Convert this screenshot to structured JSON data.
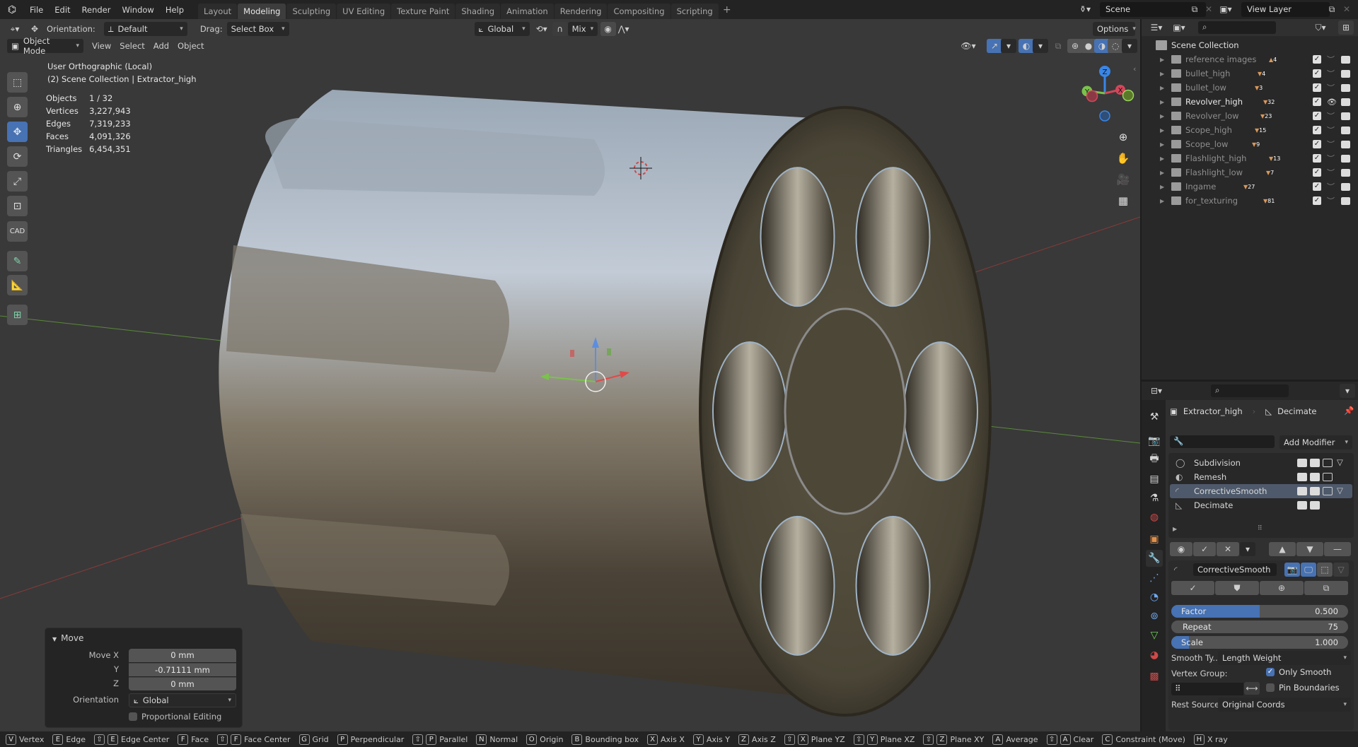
{
  "app": {
    "name": "Blender"
  },
  "menu": [
    "File",
    "Edit",
    "Render",
    "Window",
    "Help"
  ],
  "workspaces": [
    {
      "label": "Layout",
      "active": false
    },
    {
      "label": "Modeling",
      "active": true
    },
    {
      "label": "Sculpting",
      "active": false
    },
    {
      "label": "UV Editing",
      "active": false
    },
    {
      "label": "Texture Paint",
      "active": false
    },
    {
      "label": "Shading",
      "active": false
    },
    {
      "label": "Animation",
      "active": false
    },
    {
      "label": "Rendering",
      "active": false
    },
    {
      "label": "Compositing",
      "active": false
    },
    {
      "label": "Scripting",
      "active": false
    }
  ],
  "scene": {
    "name": "Scene",
    "view_layer": "View Layer"
  },
  "tool_header": {
    "orientation_label": "Orientation:",
    "orientation_value": "Default",
    "drag_label": "Drag:",
    "drag_value": "Select Box",
    "transform_orientation": "Global",
    "snap_mode": "Mix",
    "options_label": "Options"
  },
  "viewport_header": {
    "mode": "Object Mode",
    "menus": [
      "View",
      "Select",
      "Add",
      "Object"
    ]
  },
  "viewport_overlay": {
    "view_name": "User Orthographic (Local)",
    "context": "(2) Scene Collection | Extractor_high",
    "stats": [
      {
        "label": "Objects",
        "value": "1 / 32"
      },
      {
        "label": "Vertices",
        "value": "3,227,943"
      },
      {
        "label": "Edges",
        "value": "7,319,233"
      },
      {
        "label": "Faces",
        "value": "4,091,326"
      },
      {
        "label": "Triangles",
        "value": "6,454,351"
      }
    ]
  },
  "gizmo": {
    "z": "Z",
    "y": "Y",
    "x": "X"
  },
  "toolbar": {
    "tools": [
      "select-box",
      "cursor",
      "move",
      "rotate",
      "scale",
      "transform",
      "cad",
      "annotate",
      "measure",
      "add-cube"
    ],
    "active": "move",
    "cad_label": "CAD"
  },
  "last_operator": {
    "title": "Move",
    "fields": [
      {
        "label": "Move X",
        "value": "0 mm"
      },
      {
        "label": "Y",
        "value": "-0.71111 mm"
      },
      {
        "label": "Z",
        "value": "0 mm"
      }
    ],
    "orientation_label": "Orientation",
    "orientation_value": "Global",
    "proportional_label": "Proportional Editing",
    "proportional_checked": false
  },
  "outliner": {
    "root": "Scene Collection",
    "collections": [
      {
        "name": "reference images",
        "count": "4",
        "type": "image",
        "visible": false
      },
      {
        "name": "bullet_high",
        "count": "4",
        "type": "mesh",
        "visible": false
      },
      {
        "name": "bullet_low",
        "count": "3",
        "type": "mesh",
        "visible": false
      },
      {
        "name": "Revolver_high",
        "count": "32",
        "type": "mesh",
        "visible": true
      },
      {
        "name": "Revolver_low",
        "count": "23",
        "type": "mesh",
        "visible": false
      },
      {
        "name": "Scope_high",
        "count": "15",
        "type": "mesh",
        "visible": false
      },
      {
        "name": "Scope_low",
        "count": "9",
        "type": "mesh",
        "visible": false
      },
      {
        "name": "Flashlight_high",
        "count": "13",
        "type": "mesh",
        "visible": false
      },
      {
        "name": "Flashlight_low",
        "count": "7",
        "type": "mesh",
        "visible": false
      },
      {
        "name": "Ingame",
        "count": "27",
        "type": "mesh",
        "visible": false
      },
      {
        "name": "for_texturing",
        "count": "81",
        "type": "mesh",
        "visible": false
      }
    ]
  },
  "properties": {
    "object_name": "Extractor_high",
    "modifier_name": "Decimate",
    "add_modifier": "Add Modifier",
    "modifiers": [
      {
        "name": "Subdivision",
        "selected": false
      },
      {
        "name": "Remesh",
        "selected": false
      },
      {
        "name": "CorrectiveSmooth",
        "selected": true
      },
      {
        "name": "Decimate",
        "selected": false
      }
    ],
    "active_modifier": {
      "name": "CorrectiveSmooth",
      "factor": {
        "label": "Factor",
        "value": "0.500",
        "fraction": 0.5
      },
      "repeat": {
        "label": "Repeat",
        "value": "75"
      },
      "scale": {
        "label": "Scale",
        "value": "1.000",
        "fraction": 0.1
      },
      "smooth_type_label": "Smooth Ty...",
      "smooth_type_value": "Length Weight",
      "vertex_group_label": "Vertex Group:",
      "only_smooth_label": "Only Smooth",
      "only_smooth_checked": true,
      "pin_boundaries_label": "Pin Boundaries",
      "pin_boundaries_checked": false,
      "rest_source_label": "Rest Source:",
      "rest_source_value": "Original Coords"
    }
  },
  "statusbar": [
    {
      "keys": [
        "V"
      ],
      "label": "Vertex"
    },
    {
      "keys": [
        "E"
      ],
      "label": "Edge"
    },
    {
      "keys": [
        "⇧",
        "E"
      ],
      "label": "Edge Center"
    },
    {
      "keys": [
        "F"
      ],
      "label": "Face"
    },
    {
      "keys": [
        "⇧",
        "F"
      ],
      "label": "Face Center"
    },
    {
      "keys": [
        "G"
      ],
      "label": "Grid"
    },
    {
      "keys": [
        "P"
      ],
      "label": "Perpendicular"
    },
    {
      "keys": [
        "⇧",
        "P"
      ],
      "label": "Parallel"
    },
    {
      "keys": [
        "N"
      ],
      "label": "Normal"
    },
    {
      "keys": [
        "O"
      ],
      "label": "Origin"
    },
    {
      "keys": [
        "B"
      ],
      "label": "Bounding box"
    },
    {
      "keys": [
        "X"
      ],
      "label": "Axis X"
    },
    {
      "keys": [
        "Y"
      ],
      "label": "Axis Y"
    },
    {
      "keys": [
        "Z"
      ],
      "label": "Axis Z"
    },
    {
      "keys": [
        "⇧",
        "X"
      ],
      "label": "Plane YZ"
    },
    {
      "keys": [
        "⇧",
        "Y"
      ],
      "label": "Plane XZ"
    },
    {
      "keys": [
        "⇧",
        "Z"
      ],
      "label": "Plane XY"
    },
    {
      "keys": [
        "A"
      ],
      "label": "Average"
    },
    {
      "keys": [
        "⇧",
        "A"
      ],
      "label": "Clear"
    },
    {
      "keys": [
        "C"
      ],
      "label": "Constraint (Move)"
    },
    {
      "keys": [
        "H"
      ],
      "label": "X ray"
    }
  ]
}
